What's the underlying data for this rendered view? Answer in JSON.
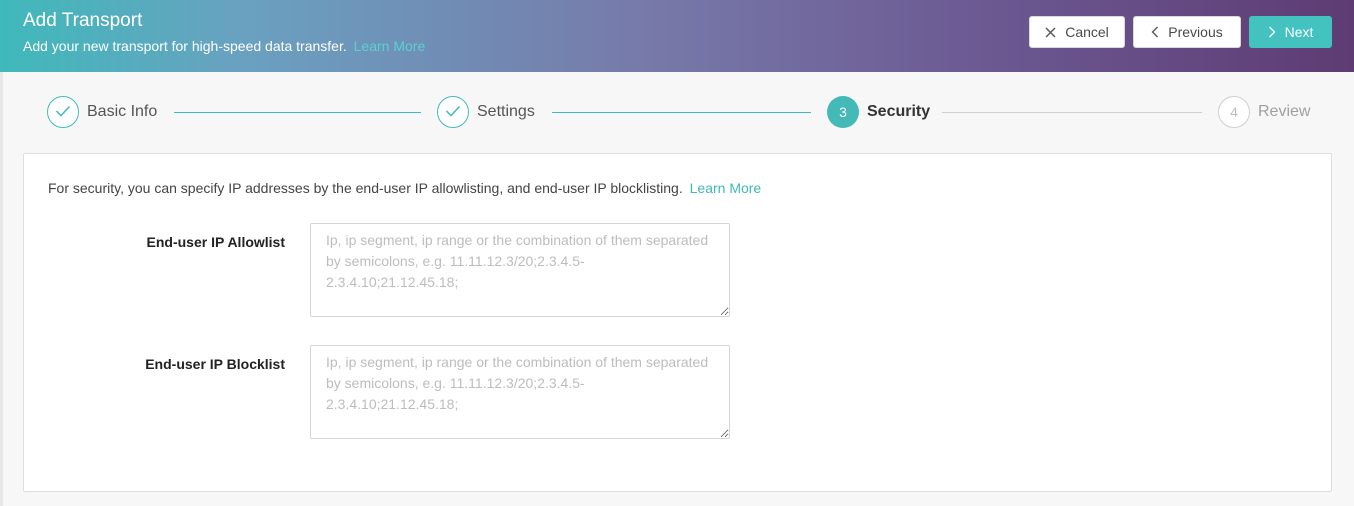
{
  "header": {
    "title": "Add Transport",
    "subtitle": "Add your new transport for high-speed data transfer.",
    "learn_more": "Learn More",
    "gradient_colors": [
      "#3fb9bb",
      "#6aa1c0",
      "#7779a9",
      "#6c5a93",
      "#5e3b73"
    ]
  },
  "actions": {
    "cancel": {
      "label": "Cancel",
      "icon": "close-icon"
    },
    "previous": {
      "label": "Previous",
      "icon": "chevron-left-icon"
    },
    "next": {
      "label": "Next",
      "icon": "chevron-right-icon"
    }
  },
  "stepper": {
    "steps": [
      {
        "number": "1",
        "label": "Basic Info",
        "status": "completed",
        "icon": "check-icon"
      },
      {
        "number": "2",
        "label": "Settings",
        "status": "completed",
        "icon": "check-icon"
      },
      {
        "number": "3",
        "label": "Security",
        "status": "active"
      },
      {
        "number": "4",
        "label": "Review",
        "status": "pending"
      }
    ],
    "accent_color": "#43bab8"
  },
  "security": {
    "intro": "For security, you can specify IP addresses by the end-user IP allowlisting, and end-user IP blocklisting.",
    "learn_more": "Learn More",
    "allowlist": {
      "label": "End-user IP Allowlist",
      "value": "",
      "placeholder": "Ip, ip segment, ip range or the combination of them separated by semicolons, e.g. 11.11.12.3/20;2.3.4.5-2.3.4.10;21.12.45.18;"
    },
    "blocklist": {
      "label": "End-user IP Blocklist",
      "value": "",
      "placeholder": "Ip, ip segment, ip range or the combination of them separated by semicolons, e.g. 11.11.12.3/20;2.3.4.5-2.3.4.10;21.12.45.18;"
    }
  }
}
